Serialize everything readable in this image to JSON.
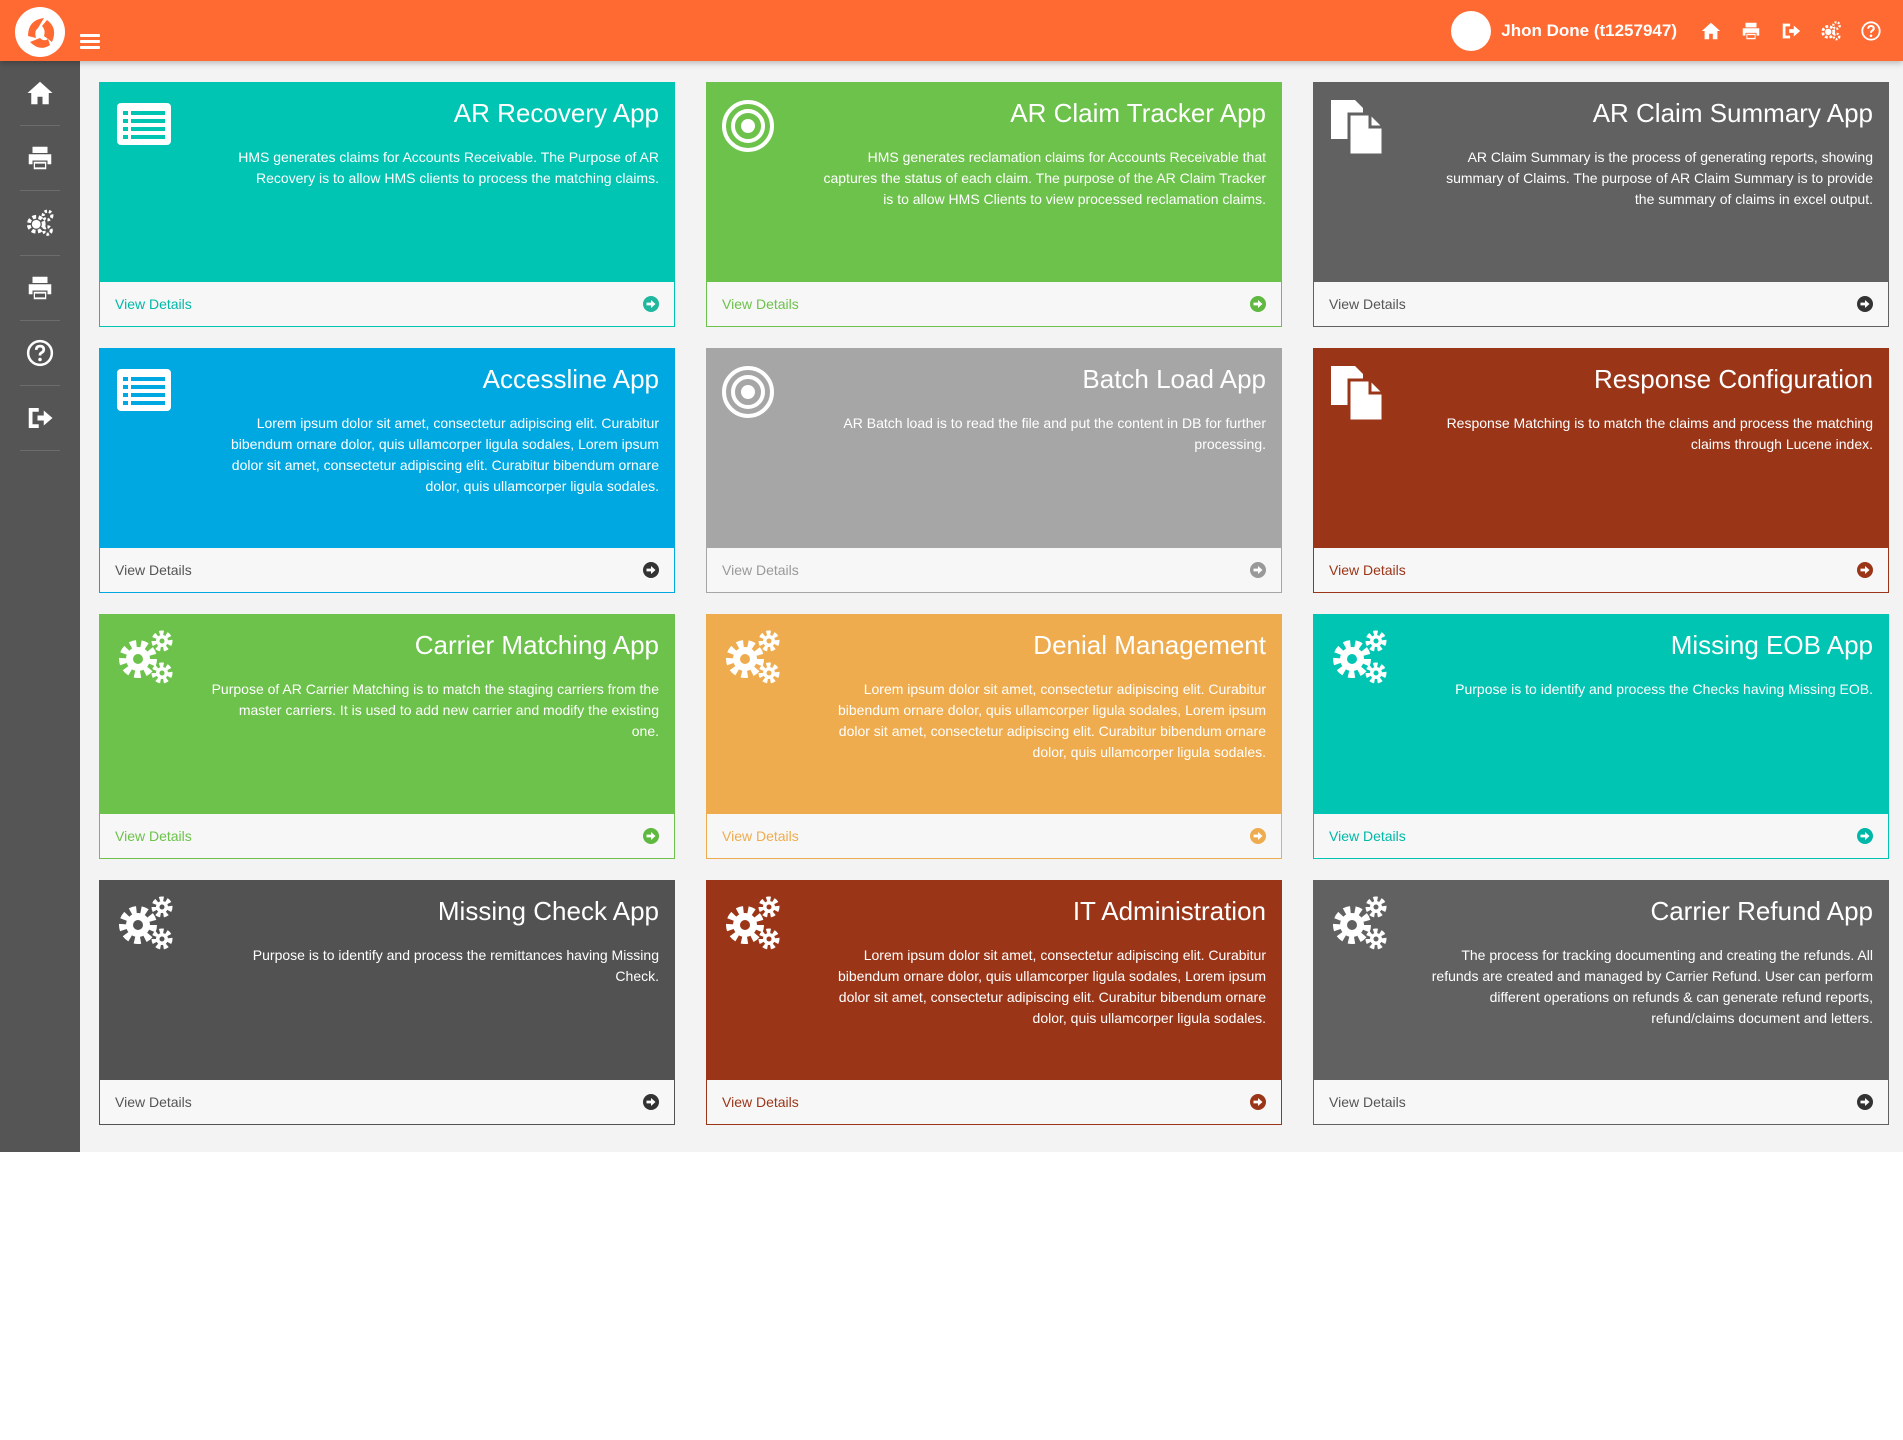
{
  "header": {
    "user_name": "Jhon Done (t1257947)",
    "accent_color": "#ff6a32",
    "icons": [
      "home-icon",
      "print-icon",
      "sign-out-icon",
      "cogs-icon",
      "help-icon"
    ]
  },
  "sidebar": {
    "items": [
      {
        "icon": "home-icon"
      },
      {
        "icon": "print-icon"
      },
      {
        "icon": "cogs-icon"
      },
      {
        "icon": "print-icon"
      },
      {
        "icon": "help-icon"
      },
      {
        "icon": "sign-out-icon"
      }
    ]
  },
  "cards": [
    {
      "title": "AR Recovery App",
      "description": "HMS generates claims for Accounts Receivable. The Purpose of AR Recovery is to allow HMS clients to process the matching claims.",
      "link": "View Details",
      "icon": "list-icon",
      "color": "#00c5b3",
      "link_color": "#00b8a8",
      "arrow_color": "#1fb89f"
    },
    {
      "title": "AR Claim Tracker App",
      "description": "HMS generates reclamation claims for Accounts Receivable that captures the status of each claim. The purpose of the AR Claim Tracker is to allow HMS Clients to view processed reclamation claims.",
      "link": "View Details",
      "icon": "target-icon",
      "color": "#6cc24a",
      "link_color": "#6cc24a",
      "arrow_color": "#5fb83f"
    },
    {
      "title": "AR Claim Summary App",
      "description": "AR Claim Summary is the process of generating reports, showing summary of Claims. The purpose of AR Claim Summary is to provide the summary of claims in excel output.",
      "link": "View Details",
      "icon": "files-icon",
      "color": "#616161",
      "link_color": "#555555",
      "arrow_color": "#333333"
    },
    {
      "title": "Accessline App",
      "description": "Lorem ipsum dolor sit amet, consectetur adipiscing elit. Curabitur bibendum ornare dolor, quis ullamcorper ligula sodales, Lorem ipsum dolor sit amet, consectetur adipiscing elit. Curabitur bibendum ornare dolor, quis ullamcorper ligula sodales.",
      "link": "View Details",
      "icon": "list-icon",
      "color": "#00a8e1",
      "link_color": "#555555",
      "arrow_color": "#333333"
    },
    {
      "title": "Batch Load App",
      "description": "AR Batch load is to read the file and put the content in DB for further processing.",
      "link": "View Details",
      "icon": "target-icon",
      "color": "#a6a6a6",
      "link_color": "#999999",
      "arrow_color": "#999999"
    },
    {
      "title": "Response Configuration",
      "description": "Response Matching is to match the claims and process the matching claims through Lucene index.",
      "link": "View Details",
      "icon": "files-icon",
      "color": "#9b3518",
      "link_color": "#9b3518",
      "arrow_color": "#9b3518"
    },
    {
      "title": "Carrier Matching App",
      "description": "Purpose of AR Carrier Matching is to match the staging carriers from the master carriers. It is used to add new carrier and modify the existing one.",
      "link": "View Details",
      "icon": "cogs-icon",
      "color": "#6cc24a",
      "link_color": "#6cc24a",
      "arrow_color": "#5fb83f"
    },
    {
      "title": "Denial Management",
      "description": "Lorem ipsum dolor sit amet, consectetur adipiscing elit. Curabitur bibendum ornare dolor, quis ullamcorper ligula sodales, Lorem ipsum dolor sit amet, consectetur adipiscing elit. Curabitur bibendum ornare dolor, quis ullamcorper ligula sodales.",
      "link": "View Details",
      "icon": "cogs-icon",
      "color": "#efac4e",
      "link_color": "#efac4e",
      "arrow_color": "#efac4e"
    },
    {
      "title": "Missing EOB App",
      "description": "Purpose is to identify and process the Checks having Missing EOB.",
      "link": "View Details",
      "icon": "cogs-icon",
      "color": "#00c5b3",
      "link_color": "#00b8a8",
      "arrow_color": "#00b8a8"
    },
    {
      "title": "Missing Check App",
      "description": "Purpose is to identify and process the remittances having Missing Check.",
      "link": "View Details",
      "icon": "cogs-icon",
      "color": "#525252",
      "link_color": "#555555",
      "arrow_color": "#333333"
    },
    {
      "title": "IT Administration",
      "description": "Lorem ipsum dolor sit amet, consectetur adipiscing elit. Curabitur bibendum ornare dolor, quis ullamcorper ligula sodales, Lorem ipsum dolor sit amet, consectetur adipiscing elit. Curabitur bibendum ornare dolor, quis ullamcorper ligula sodales.",
      "link": "View Details",
      "icon": "cogs-icon",
      "color": "#9b3518",
      "link_color": "#9b3518",
      "arrow_color": "#9b3518"
    },
    {
      "title": "Carrier Refund App",
      "description": "The process for tracking documenting and creating the refunds. All refunds are created and managed by Carrier Refund. User can perform different operations on refunds & can generate refund reports, refund/claims document and letters.",
      "link": "View Details",
      "icon": "cogs-icon",
      "color": "#616161",
      "link_color": "#555555",
      "arrow_color": "#333333"
    }
  ]
}
